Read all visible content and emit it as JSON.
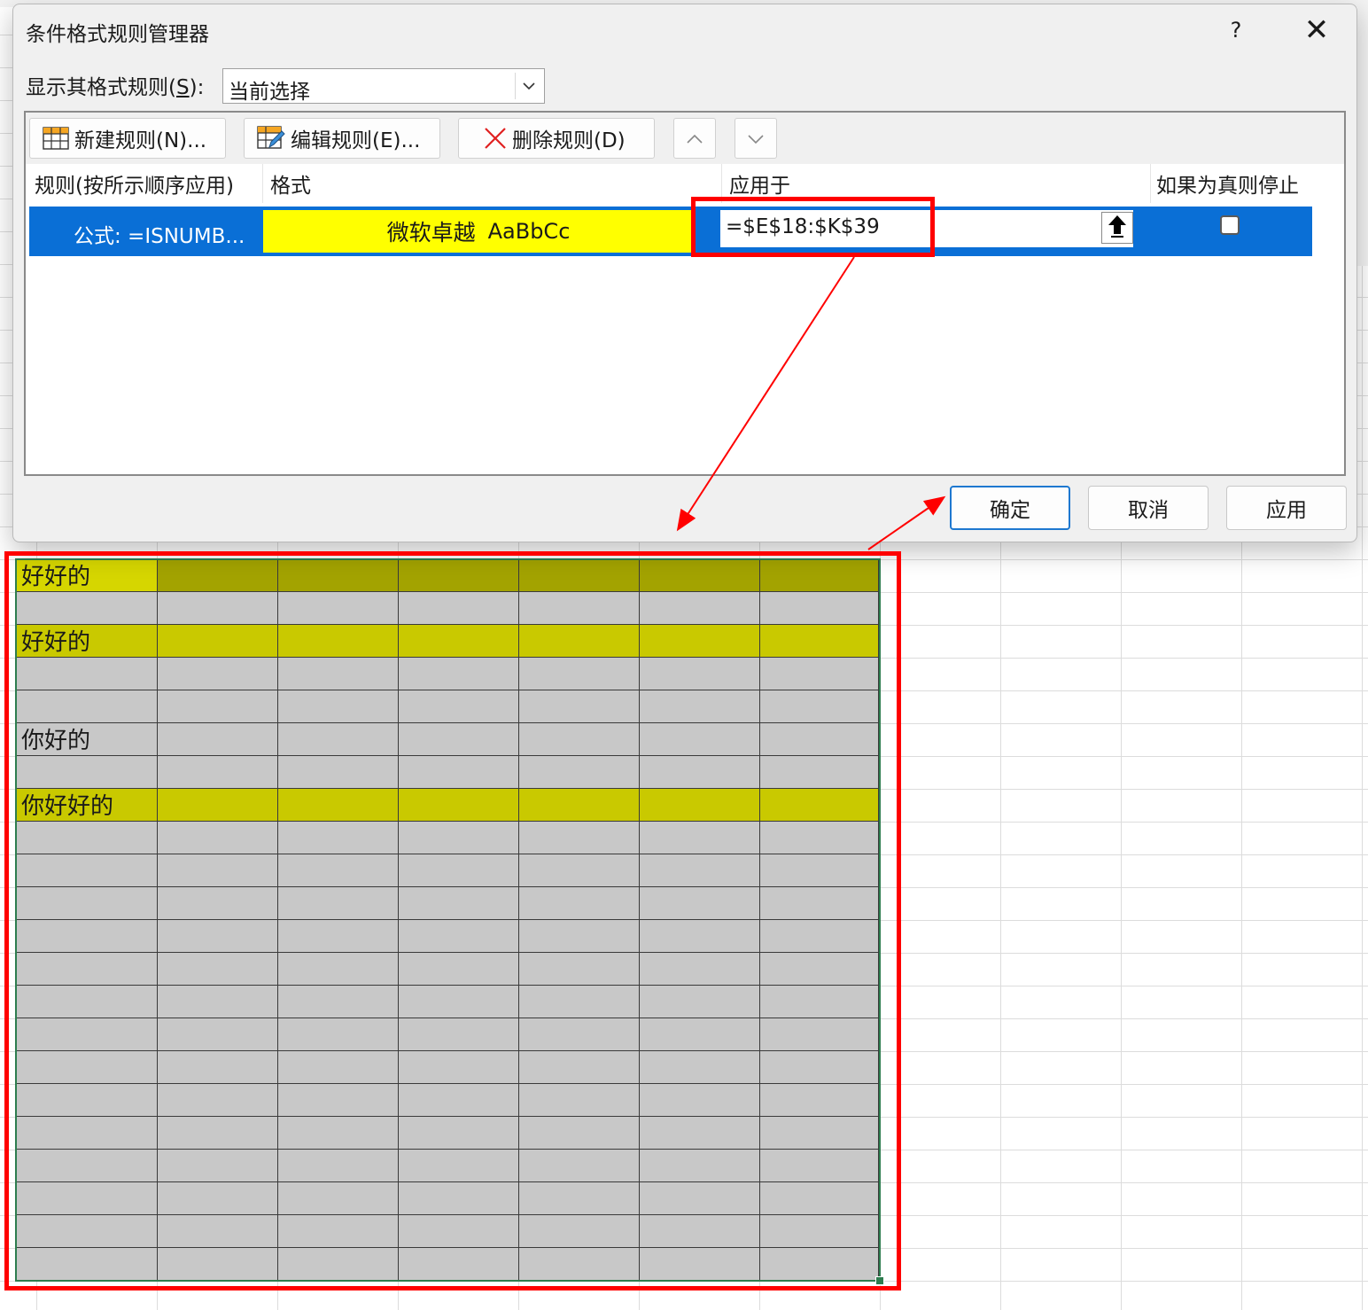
{
  "dialog": {
    "title": "条件格式规则管理器",
    "help": "?",
    "close": "✕",
    "show_rules": {
      "label_prefix": "显示其格式规则(",
      "label_key": "S",
      "label_suffix": "):",
      "selected_value": "当前选择"
    },
    "toolbar": {
      "new_rule": "新建规则(N)...",
      "edit_rule": "编辑规则(E)...",
      "delete_rule": "删除规则(D)"
    },
    "columns": {
      "rule": "规则(按所示顺序应用)",
      "format": "格式",
      "applies_to": "应用于",
      "stop_if_true": "如果为真则停止"
    },
    "rule": {
      "text": "公式: =ISNUMB...",
      "format_preview_cn": "微软卓越",
      "format_preview_latin": "AaBbCc",
      "applies_to": "=$E$18:$K$39",
      "stop_if_true": false
    },
    "buttons": {
      "ok": "确定",
      "cancel": "取消",
      "apply": "应用"
    }
  },
  "sheet": {
    "rows": [
      {
        "text": "好好的",
        "highlight": "olive"
      },
      {
        "text": "",
        "highlight": "none"
      },
      {
        "text": "好好的",
        "highlight": "yellow"
      },
      {
        "text": "",
        "highlight": "none"
      },
      {
        "text": "",
        "highlight": "none"
      },
      {
        "text": "你好的",
        "highlight": "none"
      },
      {
        "text": "",
        "highlight": "none"
      },
      {
        "text": "你好好的",
        "highlight": "yellow"
      },
      {
        "text": "",
        "highlight": "none"
      },
      {
        "text": "",
        "highlight": "none"
      },
      {
        "text": "",
        "highlight": "none"
      },
      {
        "text": "",
        "highlight": "none"
      },
      {
        "text": "",
        "highlight": "none"
      },
      {
        "text": "",
        "highlight": "none"
      },
      {
        "text": "",
        "highlight": "none"
      },
      {
        "text": "",
        "highlight": "none"
      },
      {
        "text": "",
        "highlight": "none"
      },
      {
        "text": "",
        "highlight": "none"
      },
      {
        "text": "",
        "highlight": "none"
      },
      {
        "text": "",
        "highlight": "none"
      },
      {
        "text": "",
        "highlight": "none"
      },
      {
        "text": "",
        "highlight": "none"
      }
    ]
  },
  "colors": {
    "selection_blue": "#0a6fd6",
    "format_yellow": "#ffff00",
    "highlight_yellow": "#c9c900",
    "highlight_olive": "#a3a300",
    "active_cell_yellow": "#d6d600",
    "range_gray": "#c8c8c8",
    "annotation_red": "#ff0000",
    "range_border_green": "#2e7d4f"
  },
  "icons": {
    "new_rule": "table-grid-icon",
    "edit_rule": "table-edit-icon",
    "delete_rule": "red-x-icon",
    "move_up": "chevron-up-icon",
    "move_down": "chevron-down-icon",
    "collapse": "arrow-up-icon",
    "dropdown": "chevron-down-icon"
  }
}
